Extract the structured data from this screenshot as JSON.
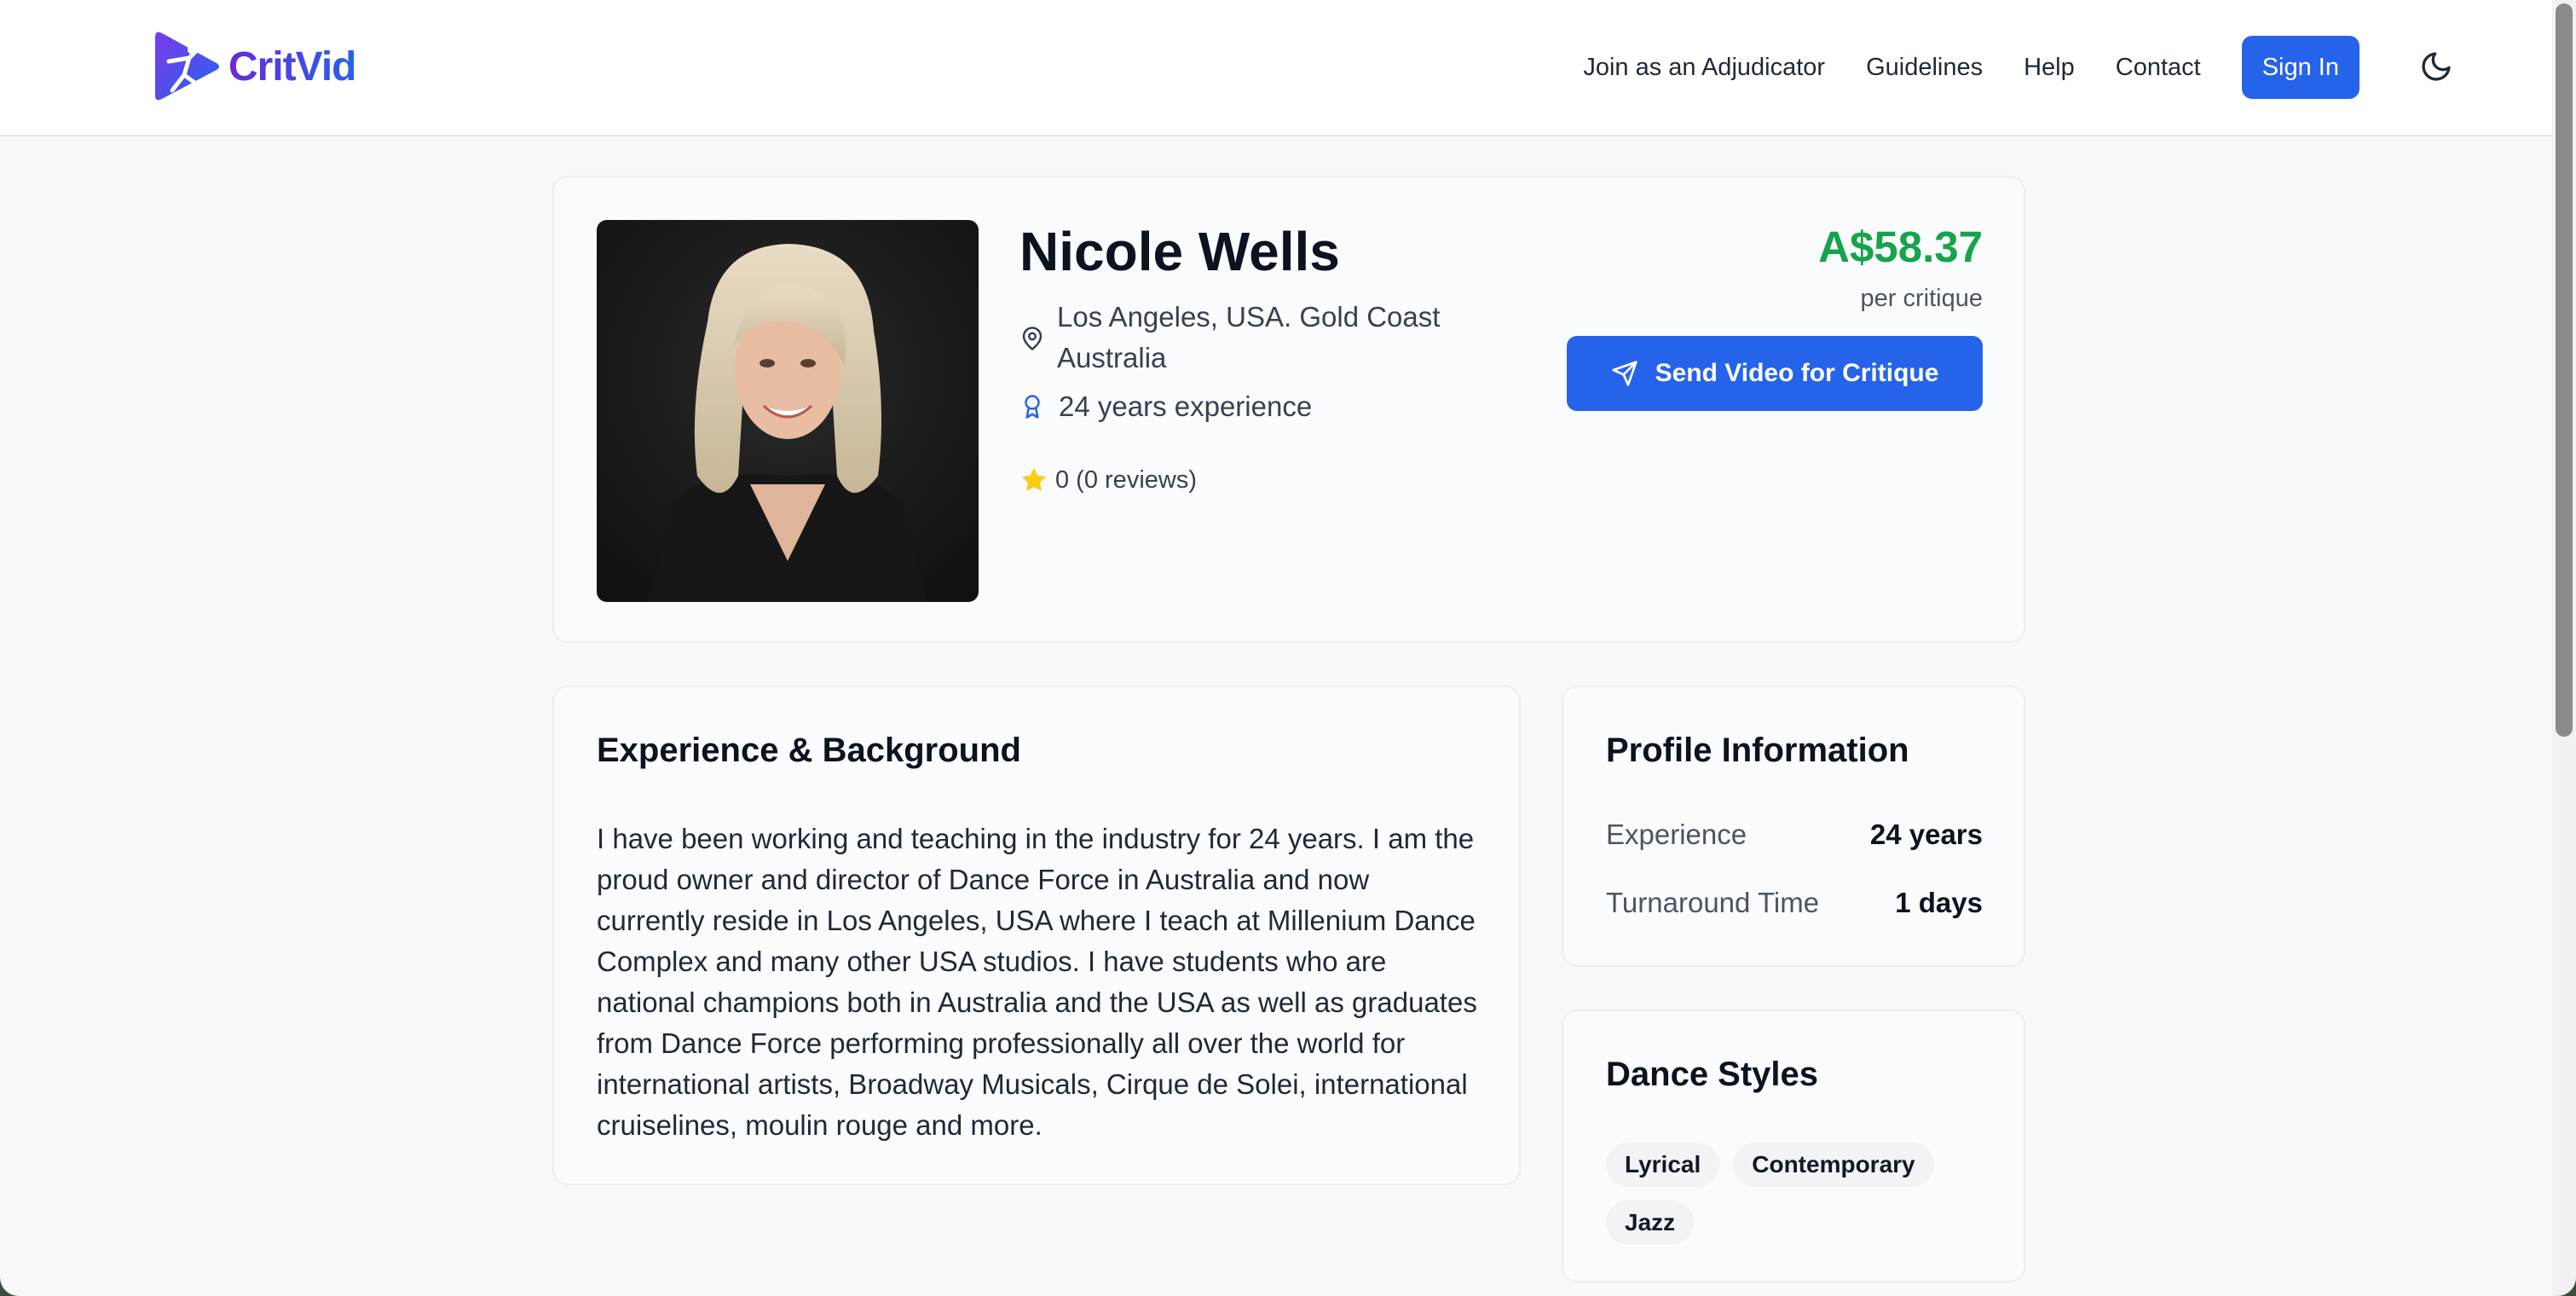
{
  "brand": {
    "name": "CritVid"
  },
  "nav": {
    "items": [
      "Join as an Adjudicator",
      "Guidelines",
      "Help",
      "Contact"
    ],
    "sign_in": "Sign In"
  },
  "profile": {
    "name": "Nicole Wells",
    "location": "Los Angeles, USA. Gold Coast Australia",
    "experience": "24 years experience",
    "rating": "0 (0 reviews)",
    "price": "A$58.37",
    "price_unit": "per critique",
    "cta": "Send Video for Critique"
  },
  "experience_section": {
    "title": "Experience & Background",
    "bio": "I have been working and teaching in the industry for 24 years. I am the proud owner and director of Dance Force in Australia and now currently reside in Los Angeles, USA where I teach at Millenium Dance Complex and many other USA studios. I have students who are national champions both in Australia and the USA as well as graduates from Dance Force performing professionally all over the world for international artists, Broadway Musicals, Cirque de Solei, international cruiselines, moulin rouge and more."
  },
  "profile_info": {
    "title": "Profile Information",
    "rows": [
      {
        "label": "Experience",
        "value": "24 years"
      },
      {
        "label": "Turnaround Time",
        "value": "1 days"
      }
    ]
  },
  "dance_styles": {
    "title": "Dance Styles",
    "items": [
      "Lyrical",
      "Contemporary",
      "Jazz"
    ]
  },
  "colors": {
    "primary": "#2563eb",
    "price": "#16a34a",
    "brand_gradient_start": "#6d28d9",
    "brand_gradient_end": "#2563eb",
    "rating_star": "#facc15"
  },
  "icons": [
    "brand-logo",
    "moon-icon",
    "map-pin-icon",
    "award-icon",
    "star-icon",
    "send-icon"
  ]
}
